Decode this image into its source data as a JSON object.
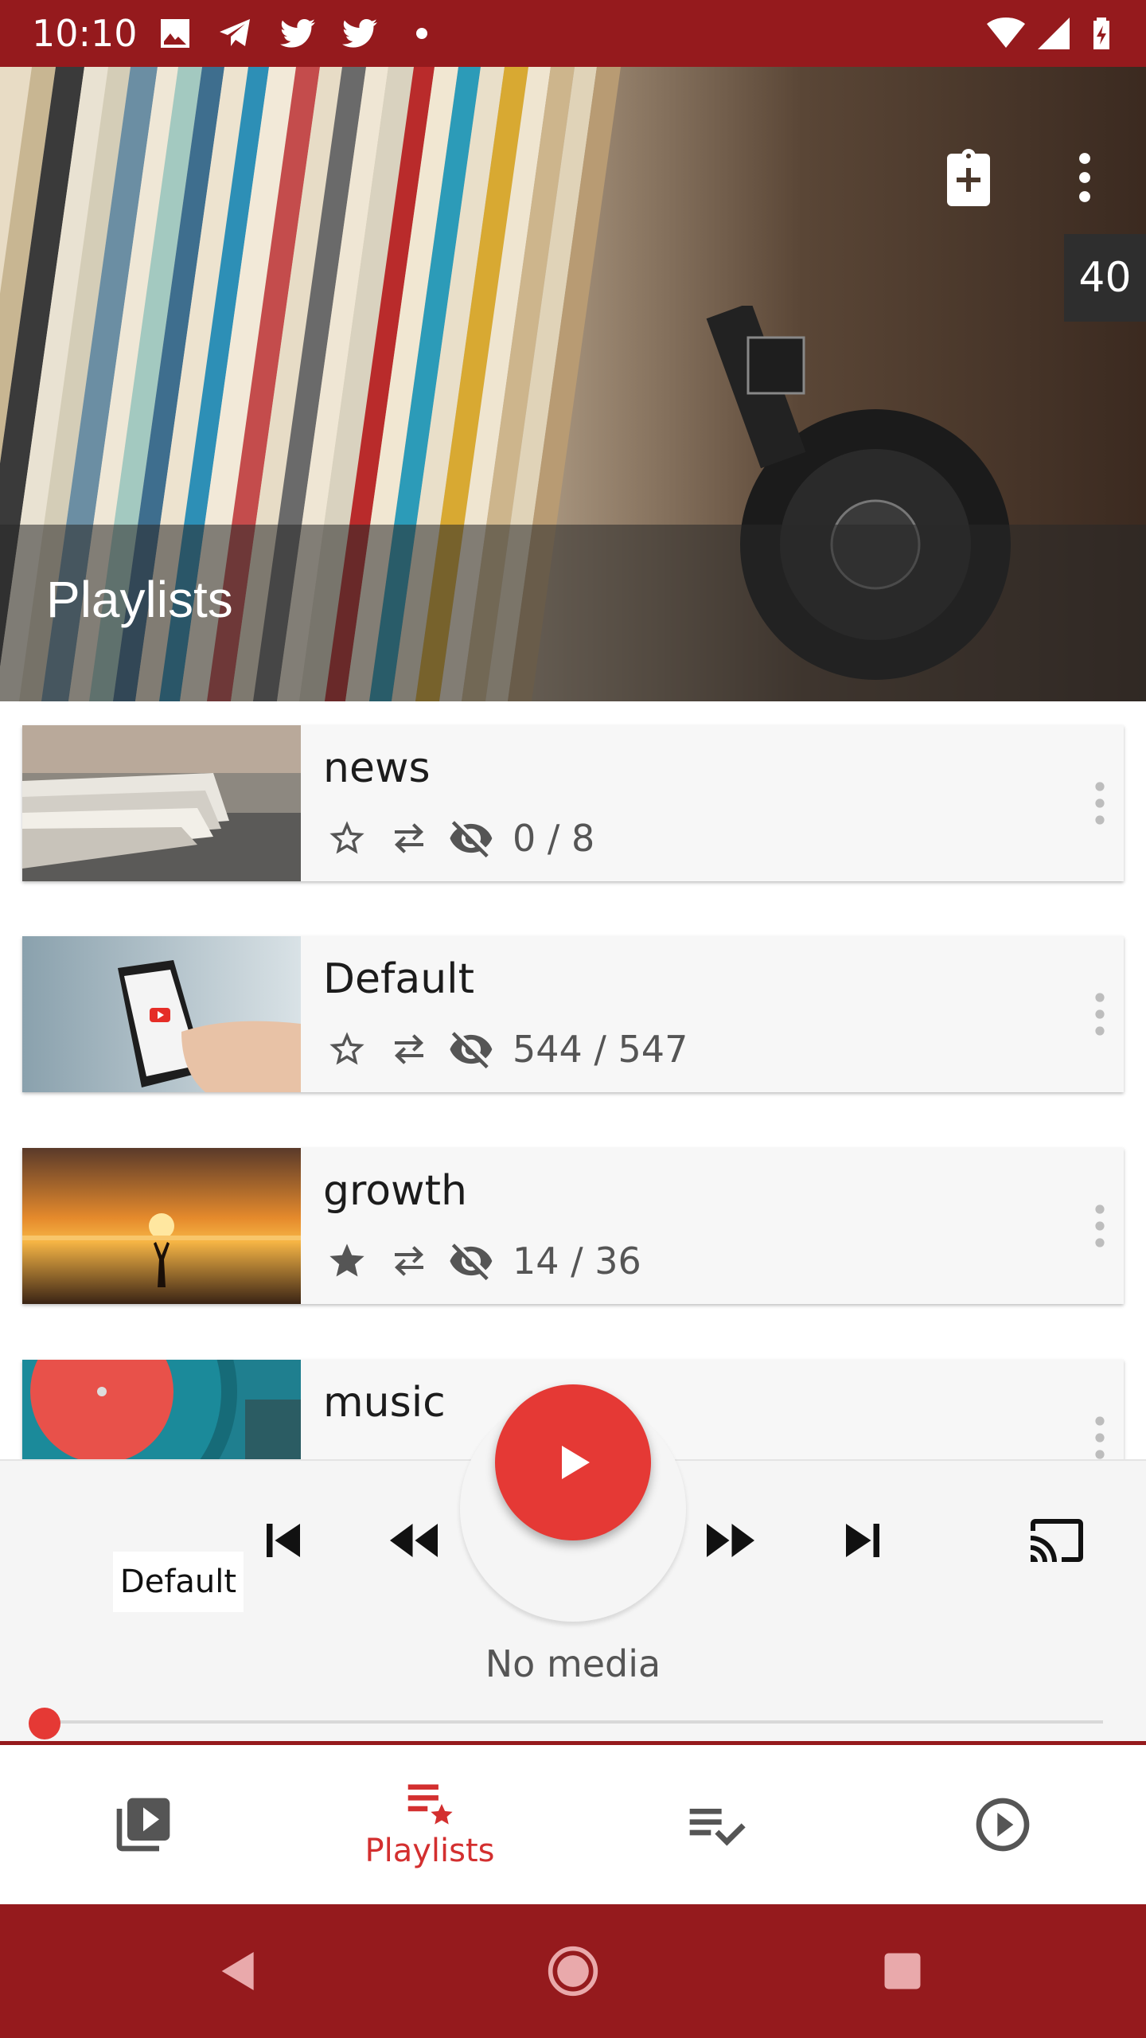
{
  "status_bar": {
    "time": "10:10",
    "icons": [
      "image-icon",
      "telegram-icon",
      "twitter-icon",
      "twitter-icon",
      "dot-icon",
      "wifi-icon",
      "signal-icon",
      "battery-icon"
    ]
  },
  "header": {
    "title": "Playlists",
    "count_badge": "40",
    "actions": [
      "clipboard-add-icon",
      "more-vertical-icon"
    ]
  },
  "playlists": [
    {
      "title": "news",
      "count": "0 / 8",
      "favorite": false,
      "thumb": "newspapers"
    },
    {
      "title": "Default",
      "count": "544 / 547",
      "favorite": false,
      "thumb": "phone-youtube"
    },
    {
      "title": "growth",
      "count": "14 / 36",
      "favorite": true,
      "thumb": "sunset"
    },
    {
      "title": "music",
      "count": "",
      "favorite": false,
      "thumb": "vinyl-record"
    }
  ],
  "player": {
    "playlist_label": "Default",
    "status_text": "No media",
    "progress": 0,
    "controls": [
      "skip-previous-icon",
      "rewind-icon",
      "play-icon",
      "fast-forward-icon",
      "skip-next-icon",
      "cast-icon"
    ]
  },
  "bottom_nav": {
    "items": [
      {
        "icon": "video-library-icon",
        "label": ""
      },
      {
        "icon": "playlist-star-icon",
        "label": "Playlists",
        "active": true
      },
      {
        "icon": "playlist-check-icon",
        "label": ""
      },
      {
        "icon": "play-circle-icon",
        "label": ""
      }
    ]
  },
  "colors": {
    "primary_dark": "#951a1d",
    "accent": "#e53935",
    "active_nav": "#d32f2f"
  }
}
